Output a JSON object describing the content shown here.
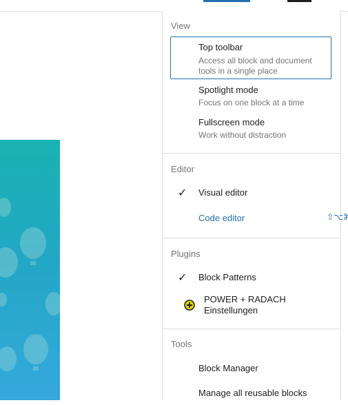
{
  "menu": {
    "view": {
      "title": "View",
      "items": [
        {
          "label": "Top toolbar",
          "desc": "Access all block and document tools in a single place"
        },
        {
          "label": "Spotlight mode",
          "desc": "Focus on one block at a time"
        },
        {
          "label": "Fullscreen mode",
          "desc": "Work without distraction"
        }
      ]
    },
    "editor": {
      "title": "Editor",
      "visual": "Visual editor",
      "code": "Code editor",
      "code_shortcut": "⇧⌥⌘M"
    },
    "plugins": {
      "title": "Plugins",
      "block_patterns": "Block Patterns",
      "power_line1": "POWER + RADACH",
      "power_line2": "Einstellungen"
    },
    "tools": {
      "title": "Tools",
      "block_manager": "Block Manager",
      "manage_reusable": "Manage all reusable blocks"
    }
  },
  "icons": {
    "checkmark": "check-icon",
    "plugin": "plus-circle-icon"
  },
  "colors": {
    "accent": "#2271b1",
    "plugin_icon": "#e6d400",
    "cover_top": "#19b3b3",
    "cover_bottom": "#35a8dc"
  }
}
